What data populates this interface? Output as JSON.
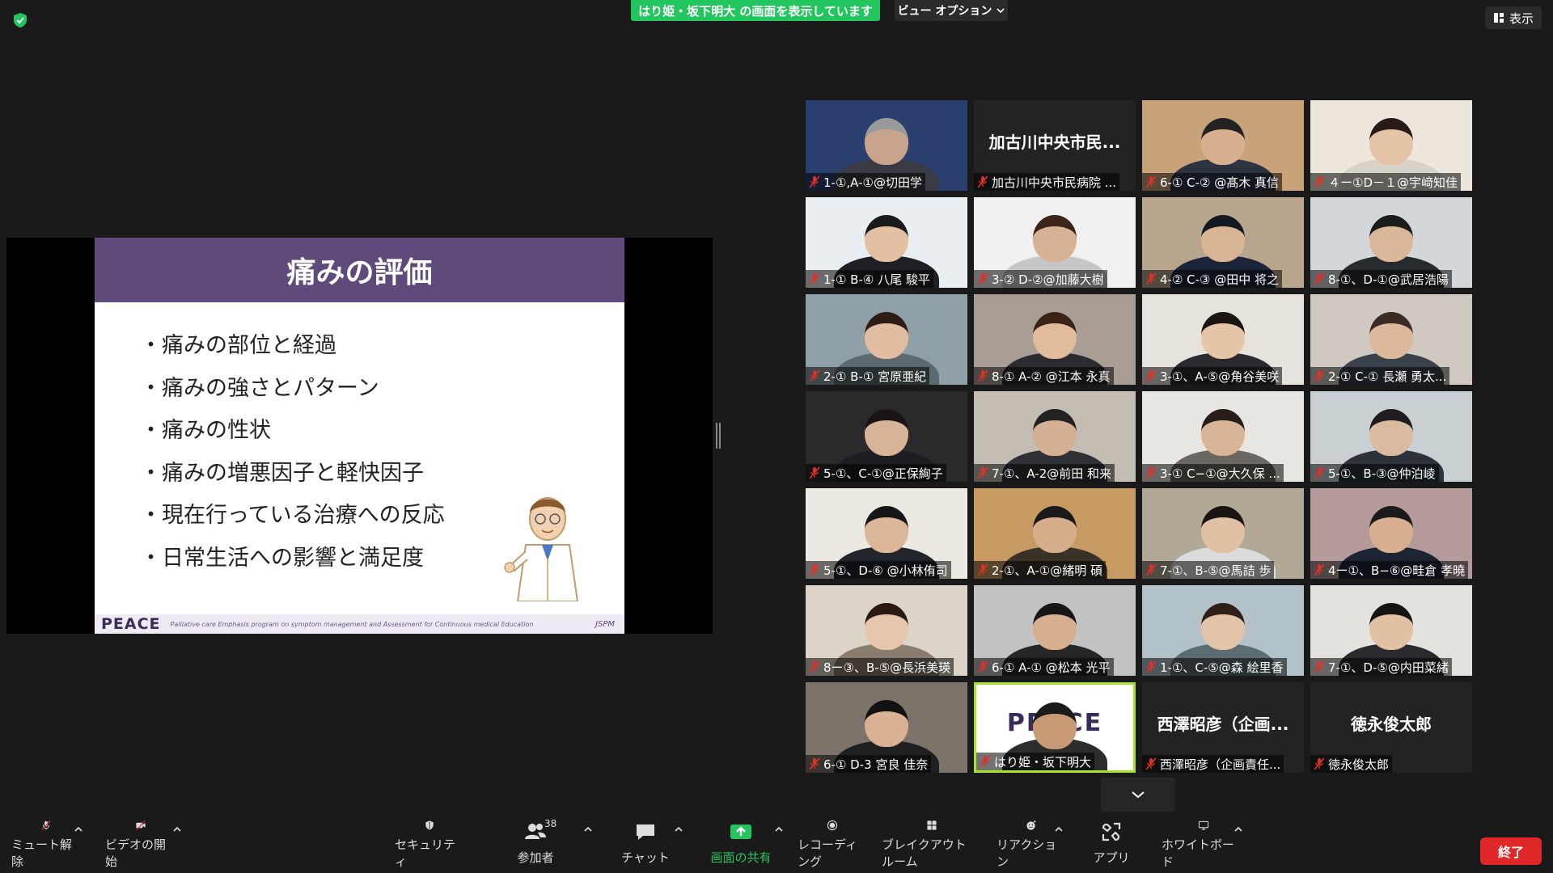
{
  "banner": {
    "share_text": "はり姫・坂下明大 の画面を表示しています",
    "view_options": "ビュー オプション"
  },
  "view_button": {
    "label": "表示"
  },
  "slide": {
    "title": "痛みの評価",
    "bullets": [
      "痛みの部位と経過",
      "痛みの強さとパターン",
      "痛みの性状",
      "痛みの増悪因子と軽快因子",
      "現在行っている治療への反応",
      "日常生活への影響と満足度"
    ],
    "footer_logo": "PEACE",
    "footer_subtitle": "Palliative care Emphasis program on symptom management and Assessment for Continuous medical Education",
    "footer_org": "JSPM"
  },
  "participants": [
    {
      "name": "1-①,A-①@切田学",
      "bg": "#2a3f6e",
      "skin": "#c8a48c",
      "hair": "#9a9a9a",
      "shirt": "#3a3a44"
    },
    {
      "name": "加古川中央市民病院 ...",
      "big_name": "加古川中央市民...",
      "video": false
    },
    {
      "name": "6-① C-② @髙木 真信",
      "bg": "#c8a37a",
      "skin": "#d8b090",
      "hair": "#222",
      "shirt": "#2d3340"
    },
    {
      "name": "４ー①D－１@宇﨑知佳",
      "bg": "#ece6dc",
      "skin": "#e4c3a6",
      "hair": "#2a1a15",
      "shirt": "#d8d2c8"
    },
    {
      "name": "1-① B-④ 八尾 駿平",
      "bg": "#e9eef2",
      "skin": "#e3c0a2",
      "hair": "#1a1a1a",
      "shirt": "#1f1f24"
    },
    {
      "name": "3-② D-②@加藤大樹",
      "bg": "#f1f1f1",
      "skin": "#d8b294",
      "hair": "#3b2418",
      "shirt": "#c7c7c7"
    },
    {
      "name": "4-② C-③ @田中 将之",
      "bg": "#b7a58d",
      "skin": "#d9b494",
      "hair": "#141820",
      "shirt": "#1b2438"
    },
    {
      "name": "8-①、D-①@武居浩陽",
      "bg": "#d4d7da",
      "skin": "#dbb79a",
      "hair": "#1c1c1c",
      "shirt": "#262b30"
    },
    {
      "name": "2-① B-① 宮原亜紀",
      "bg": "#8fa0a8",
      "skin": "#e1bea2",
      "hair": "#2d1d16",
      "shirt": "#5c6a70"
    },
    {
      "name": "8-① A-② @江本 永真",
      "bg": "#a89e96",
      "skin": "#e0bb9c",
      "hair": "#3a2418",
      "shirt": "#2c2c30"
    },
    {
      "name": "3-①、A-⑤@角谷美咲",
      "bg": "#e6e2dc",
      "skin": "#e6c4a8",
      "hair": "#1b1414",
      "shirt": "#2a2a2e"
    },
    {
      "name": "2-① C-① 長瀬 勇太...",
      "bg": "#cfc9c2",
      "skin": "#ddb99c",
      "hair": "#3a2c24",
      "shirt": "#39414a"
    },
    {
      "name": "5-①、C-①@正保絢子",
      "bg": "#2a2a2d",
      "skin": "#d8b496",
      "hair": "#1a1414",
      "shirt": "#1e1e22"
    },
    {
      "name": "7-①、A-2@前田 和来",
      "bg": "#c4bdb4",
      "skin": "#d6b092",
      "hair": "#222",
      "shirt": "#2f3136"
    },
    {
      "name": "3-① C−①@大久保 ...",
      "bg": "#e8e6e2",
      "skin": "#d9b496",
      "hair": "#2a1e1a",
      "shirt": "#6a6660"
    },
    {
      "name": "5-①、B-③@仲泊崚",
      "bg": "#c9d0d4",
      "skin": "#dbbba0",
      "hair": "#1e1e1e",
      "shirt": "#2c343a"
    },
    {
      "name": "5-①、D-⑥ @小林侑司",
      "bg": "#ece8e2",
      "skin": "#dcb698",
      "hair": "#161616",
      "shirt": "#22252a"
    },
    {
      "name": "2-①、A-①@緒明 碩",
      "bg": "#c69a62",
      "skin": "#d7ae8c",
      "hair": "#1a1a1a",
      "shirt": "#3a3226"
    },
    {
      "name": "7-①、B-⑤@馬詰 歩",
      "bg": "#b2a896",
      "skin": "#e2c0a4",
      "hair": "#1b1512",
      "shirt": "#dcdcdc"
    },
    {
      "name": "4ー①、B−⑥@畦倉 孝曉",
      "bg": "#b59a9a",
      "skin": "#d8b090",
      "hair": "#1b1b1b",
      "shirt": "#1d2433"
    },
    {
      "name": "8ー③、B-⑤@長浜美瑛",
      "bg": "#dcd4c8",
      "skin": "#e6c6aa",
      "hair": "#2a1a12",
      "shirt": "#8a7c6e"
    },
    {
      "name": "6-① A-① @松本 光平",
      "bg": "#c2c2c2",
      "skin": "#d6b090",
      "hair": "#161616",
      "shirt": "#262626"
    },
    {
      "name": "1-①、C-⑤@森 絵里香",
      "bg": "#b2c2c8",
      "skin": "#e4c4a8",
      "hair": "#2e2018",
      "shirt": "#5c6c70"
    },
    {
      "name": "7-①、D-⑤@内田菜緒",
      "bg": "#e4e2de",
      "skin": "#e2c0a4",
      "hair": "#151212",
      "shirt": "#2a2a2e"
    },
    {
      "name": "6-① D-3 宮良 佳奈",
      "bg": "#7c746a",
      "skin": "#d8b292",
      "hair": "#121212",
      "shirt": "#202022"
    },
    {
      "name": "はり姫・坂下明大",
      "bg": "#ffffff",
      "skin": "#c89a76",
      "hair": "#1a1a1a",
      "shirt": "#2d2d2d",
      "active": true,
      "peace": "PEACE"
    },
    {
      "name": "西澤昭彦（企画責任...",
      "big_name": "西澤昭彦（企画...",
      "video": false
    },
    {
      "name": "徳永俊太郎",
      "big_name": "徳永俊太郎",
      "video": false
    }
  ],
  "toolbar": {
    "mute": "ミュート解除",
    "video": "ビデオの開始",
    "security": "セキュリティ",
    "participants": "参加者",
    "participant_count": "38",
    "chat": "チャット",
    "share": "画面の共有",
    "record": "レコーディング",
    "breakout": "ブレイクアウト ルーム",
    "reactions": "リアクション",
    "apps": "アプリ",
    "whiteboard": "ホワイトボード",
    "end": "終了"
  },
  "colors": {
    "share_green": "#23c55e",
    "slide_purple": "#5e4b7c",
    "end_red": "#e02828",
    "active_speaker": "#a6e22e",
    "muted_red": "#e0302a"
  }
}
